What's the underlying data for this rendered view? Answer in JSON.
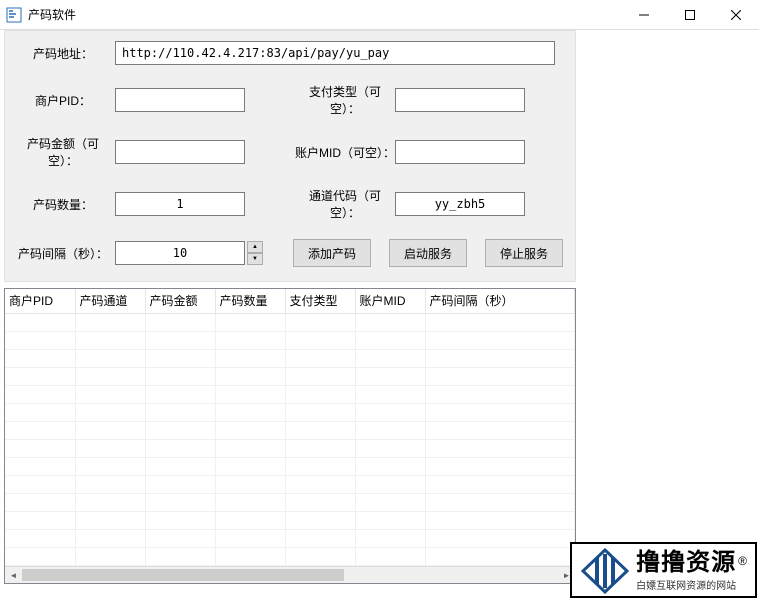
{
  "window": {
    "title": "产码软件"
  },
  "form": {
    "url_label": "产码地址：",
    "url_value": "http://110.42.4.217:83/api/pay/yu_pay",
    "pid_label": "商户PID：",
    "pid_value": "",
    "paytype_label": "支付类型（可空）：",
    "paytype_value": "",
    "amount_label": "产码金额（可空）：",
    "amount_value": "",
    "mid_label": "账户MID（可空）：",
    "mid_value": "",
    "count_label": "产码数量：",
    "count_value": "1",
    "channel_label": "通道代码（可空）：",
    "channel_value": "yy_zbh5",
    "interval_label": "产码间隔（秒）：",
    "interval_value": "10",
    "btn_add": "添加产码",
    "btn_start": "启动服务",
    "btn_stop": "停止服务"
  },
  "table": {
    "headers": {
      "h1": "商户PID",
      "h2": "产码通道",
      "h3": "产码金额",
      "h4": "产码数量",
      "h5": "支付类型",
      "h6": "账户MID",
      "h7": "产码间隔（秒）"
    }
  },
  "watermark": {
    "main": "撸撸资源",
    "reg": "®",
    "sub": "白嫖互联网资源的网站"
  }
}
